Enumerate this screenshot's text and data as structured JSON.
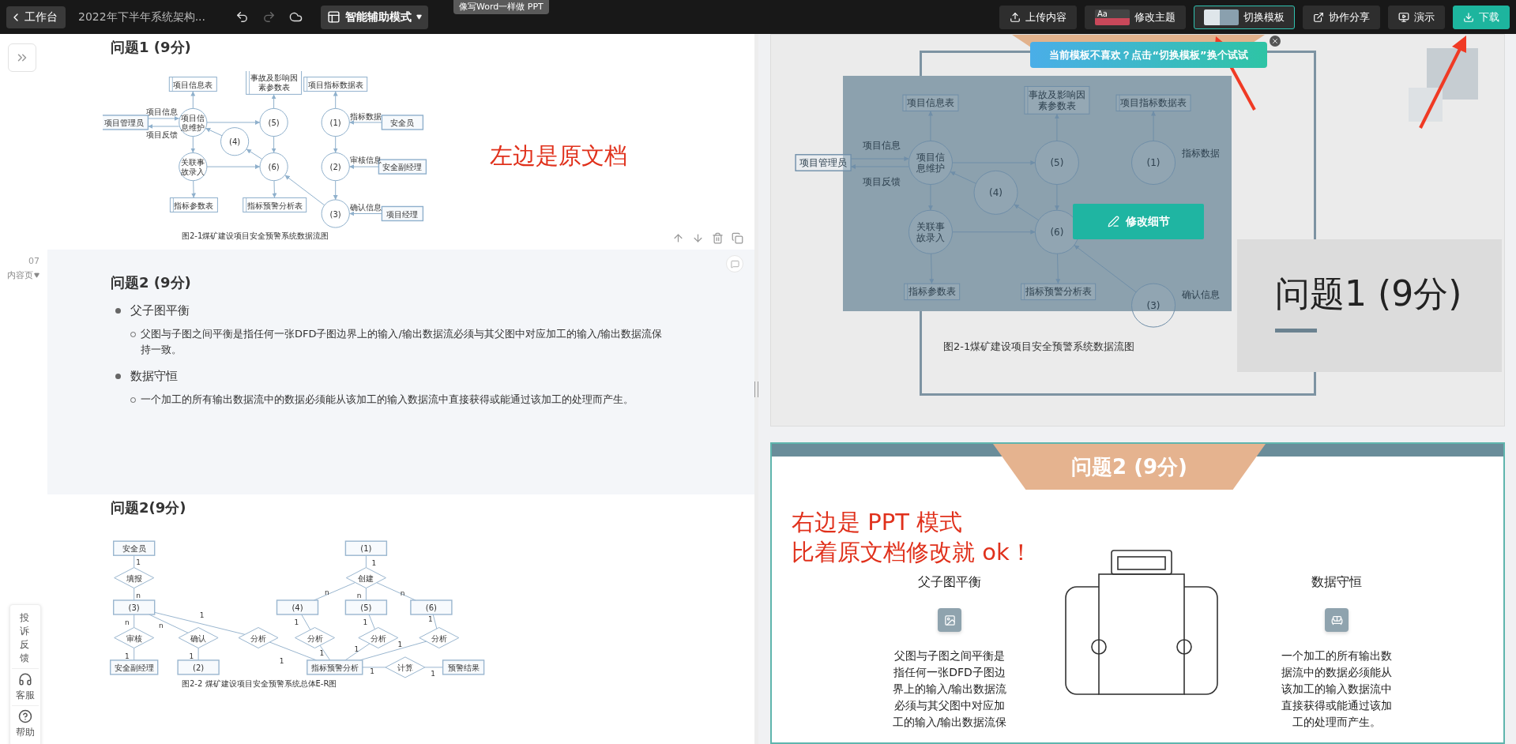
{
  "topbar": {
    "back_label": "工作台",
    "doc_title": "2022年下半年系统架构...",
    "mode_label": "智能辅助模式",
    "mode_tip": "像写Word一样做 PPT",
    "actions": [
      {
        "kind": "upload",
        "label": "上传内容"
      },
      {
        "kind": "theme",
        "label": "修改主题",
        "thumb_text": "Aa"
      },
      {
        "kind": "template",
        "label": "切换模板"
      },
      {
        "kind": "share",
        "label": "协作分享"
      },
      {
        "kind": "present",
        "label": "演示"
      },
      {
        "kind": "download",
        "label": "下载"
      }
    ]
  },
  "document": {
    "blocks": [
      {
        "kind": "figure",
        "selected": false,
        "heading": "问题1 (9分)",
        "note": "左边是原文档",
        "diagram": {
          "caption": "图2-1煤矿建设项目安全预警系统数据流图",
          "stores": [
            "项目信息表",
            "事故及影响因素参数表",
            "项目指标数据表",
            "指标参数表",
            "指标预警分析表"
          ],
          "entities": [
            "项目管理员",
            "安全员",
            "安全副经理",
            "项目经理"
          ],
          "processes": [
            "项目信息维护",
            "关联事故录入",
            "(4)",
            "(5)",
            "(6)",
            "(1)",
            "(3)",
            "(2)"
          ],
          "flows": [
            "项目信息",
            "项目反馈",
            "指标数据",
            "确认信息",
            "审核信息"
          ]
        }
      },
      {
        "kind": "bullets",
        "selected": true,
        "page_number": "07",
        "page_type": "内容页",
        "heading": "问题2 (9分)",
        "items": [
          {
            "title": "父子图平衡",
            "details": [
              "父图与子图之间平衡是指任何一张DFD子图边界上的输入/输出数据流必须与其父图中对应加工的输入/输出数据流保持一致。"
            ]
          },
          {
            "title": "数据守恒",
            "details": [
              "一个加工的所有输出数据流中的数据必须能从该加工的输入数据流中直接获得或能通过该加工的处理而产生。"
            ]
          }
        ]
      },
      {
        "kind": "figure",
        "selected": false,
        "heading": "问题2(9分)",
        "diagram": {
          "caption": "图2-2 煤矿建设项目安全预警系统总体E-R图",
          "entities": [
            "安全员",
            "(3)",
            "安全副经理",
            "(2)",
            "(1)",
            "(4)",
            "(5)",
            "(6)",
            "指标预警分析",
            "预警结果"
          ],
          "relations": [
            "填报",
            "审核",
            "确认",
            "分析",
            "创建",
            "分析",
            "分析",
            "分析",
            "计算"
          ],
          "cardinalities": [
            "1",
            "n",
            "1",
            "n",
            "n",
            "1",
            "1",
            "1",
            "1",
            "n",
            "n",
            "n",
            "1",
            "1",
            "1",
            "1",
            "1",
            "1",
            "1",
            "1"
          ]
        }
      }
    ]
  },
  "help_widget": [
    {
      "kind": "feedback",
      "label": "投诉反馈"
    },
    {
      "kind": "service",
      "label": "客服"
    },
    {
      "kind": "help",
      "label": "帮助"
    }
  ],
  "slides": [
    {
      "kind": "diagram",
      "selected": false,
      "tip": "当前模板不喜欢？点击“切换模板”换个试试",
      "title": "问题1 (9分)",
      "caption": "图2-1煤矿建设项目安全预警系统数据流图",
      "edit_button": "修改细节",
      "diagram": {
        "stores": [
          "项目信息表",
          "事故及影响因素参数表",
          "项目指标数据表",
          "指标参数表",
          "指标预警分析表"
        ],
        "entities": [
          "项目管理员"
        ],
        "processes": [
          "项目信息维护",
          "关联事故录入",
          "(4)",
          "(5)",
          "(6)",
          "(1)",
          "(3)"
        ],
        "flows": [
          "项目信息",
          "项目反馈",
          "指标数据",
          "确认信息"
        ]
      }
    },
    {
      "kind": "two_column",
      "selected": true,
      "title": "问题2 (9分)",
      "note_lines": [
        "右边是 PPT 模式",
        "比着原文档修改就 ok！"
      ],
      "columns": [
        {
          "kind": "image",
          "title": "父子图平衡",
          "text": "父图与子图之间平衡是指任何一张DFD子图边界上的输入/输出数据流必须与其父图中对应加工的输入/输出数据流保"
        },
        {
          "kind": "sofa",
          "title": "数据守恒",
          "text": "一个加工的所有输出数据流中的数据必须能从该加工的输入数据流中直接获得或能通过该加工的处理而产生。"
        }
      ]
    }
  ]
}
